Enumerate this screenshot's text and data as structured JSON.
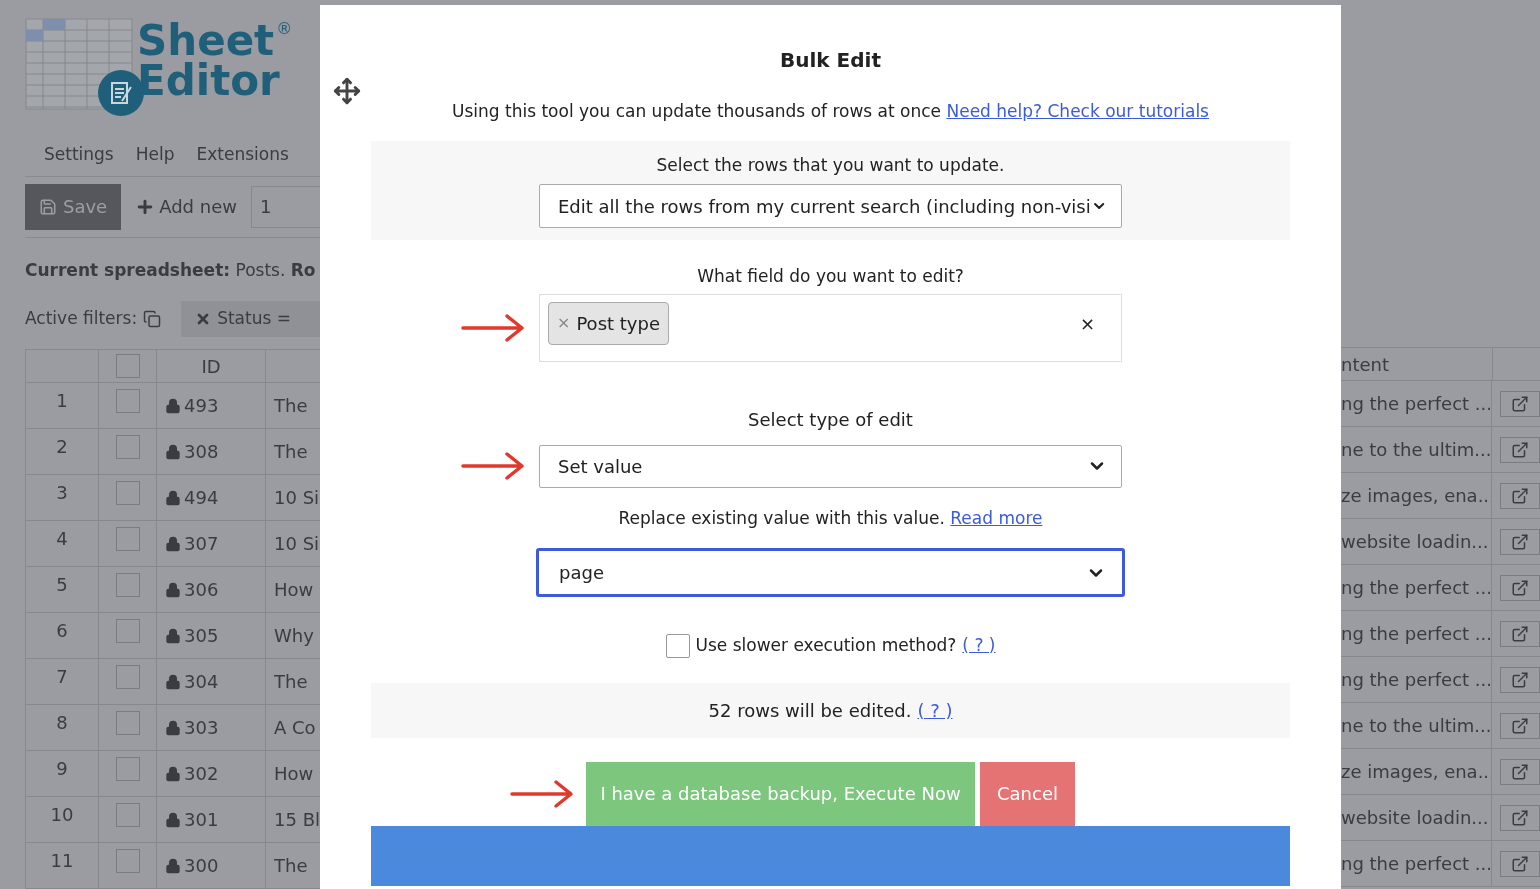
{
  "app": {
    "logo": {
      "line_1": "Sheet",
      "line_2": "Editor",
      "mark": "®"
    },
    "menu": [
      "Settings",
      "Help",
      "Extensions"
    ],
    "toolbar": {
      "save": "Save",
      "add_new": "Add new",
      "count": "1"
    },
    "current_spreadsheet": "**Current spreadsheet:** Posts. **Ro**",
    "active_filters": {
      "label": "Active filters:",
      "filter": "Status ="
    },
    "table": {
      "select_all_checked": false,
      "id_header": "ID",
      "content_header": "ntent",
      "rows": [
        {
          "number": "1",
          "checked": false,
          "id": "493",
          "title": "The",
          "content": "ng the perfect ..."
        },
        {
          "number": "2",
          "checked": false,
          "id": "308",
          "title": "The",
          "content": "ne to the ultim..."
        },
        {
          "number": "3",
          "checked": false,
          "id": "494",
          "title": "10 Si",
          "content": "ze images, ena..."
        },
        {
          "number": "4",
          "checked": false,
          "id": "307",
          "title": "10 Si",
          "content": "website loadin..."
        },
        {
          "number": "5",
          "checked": false,
          "id": "306",
          "title": "How",
          "content": "ng the perfect ..."
        },
        {
          "number": "6",
          "checked": false,
          "id": "305",
          "title": "Why",
          "content": "ng the perfect ..."
        },
        {
          "number": "7",
          "checked": false,
          "id": "304",
          "title": "The",
          "content": "ng the perfect ..."
        },
        {
          "number": "8",
          "checked": false,
          "id": "303",
          "title": "A Co",
          "content": "ne to the ultim..."
        },
        {
          "number": "9",
          "checked": false,
          "id": "302",
          "title": "How",
          "content": "ze images, ena..."
        },
        {
          "number": "10",
          "checked": false,
          "id": "301",
          "title": "15 Bl",
          "content": "website loadin..."
        },
        {
          "number": "11",
          "checked": false,
          "id": "300",
          "title": "The",
          "content": "ng the perfect ..."
        }
      ]
    }
  },
  "dialog": {
    "title": "Bulk Edit",
    "intro": "Using this tool you can update thousands of rows at once",
    "intro_link": "Need help? Check our tutorials",
    "rows_label": "Select the rows that you want to update.",
    "rows_select": "Edit all the rows from my current search (including non-visi",
    "field_label": "What field do you want to edit?",
    "field_chip": {
      "remove": "×",
      "label": "Post type"
    },
    "field_clear": "×",
    "edit_type_label": "Select type of edit",
    "edit_type_select": "Set value",
    "hint": "Replace existing value with this value.",
    "hint_link": "Read more",
    "value_select": {
      "value": "page",
      "focused": true
    },
    "slower": {
      "label": "Use slower execution method?",
      "link": "( ? )",
      "checked": false
    },
    "summary": "52 rows will be edited.",
    "summary_link": "( ? )",
    "execute": "I have a database backup, Execute Now",
    "cancel": "Cancel"
  }
}
